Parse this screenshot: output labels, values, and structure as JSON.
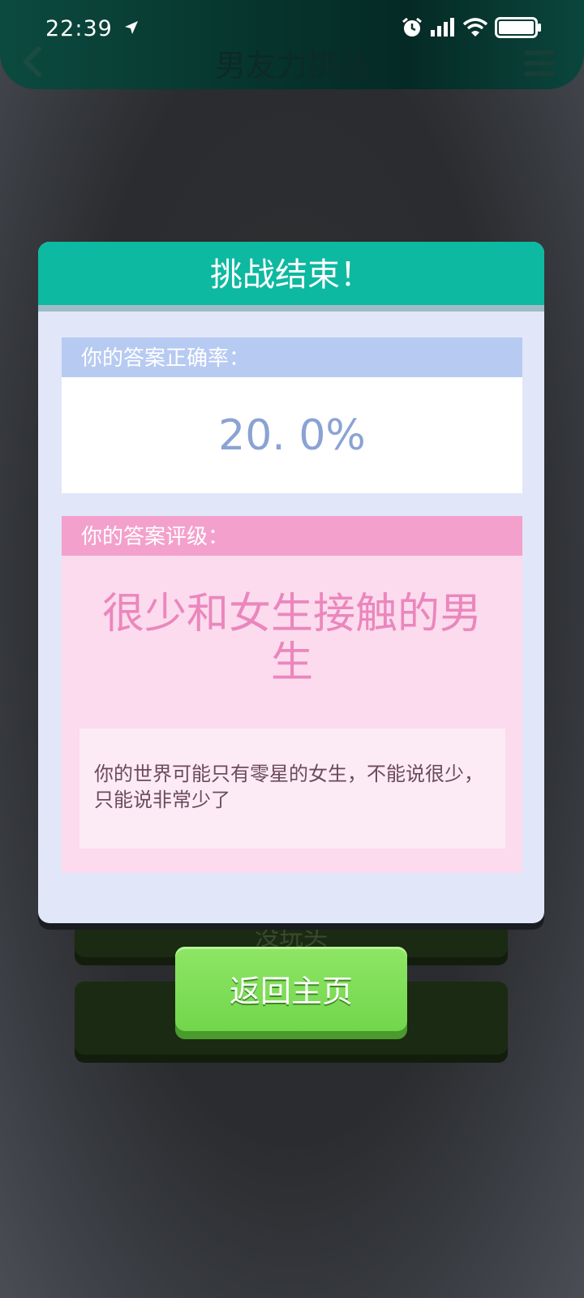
{
  "status_bar": {
    "time": "22:39",
    "icons": [
      "location-arrow-icon",
      "alarm-icon",
      "signal-icon",
      "wifi-icon",
      "battery-icon"
    ]
  },
  "header": {
    "title": "男友力挑战"
  },
  "background": {
    "button1_text": "没玩头"
  },
  "dialog": {
    "title": "挑战结束！",
    "accuracy_label": "你的答案正确率：",
    "accuracy_value": "20. 0%",
    "grade_label": "你的答案评级：",
    "grade_title": "很少和女生接触的男生",
    "grade_description": "你的世界可能只有零星的女生，不能说很少，只能说非常少了"
  },
  "actions": {
    "return_label": "返回主页"
  },
  "colors": {
    "header_bg": "#06342d",
    "dialog_head": "#0db9a0",
    "accuracy_accent": "#8aa3d3",
    "grade_accent": "#eb86bd",
    "return_button": "#72d64c"
  }
}
